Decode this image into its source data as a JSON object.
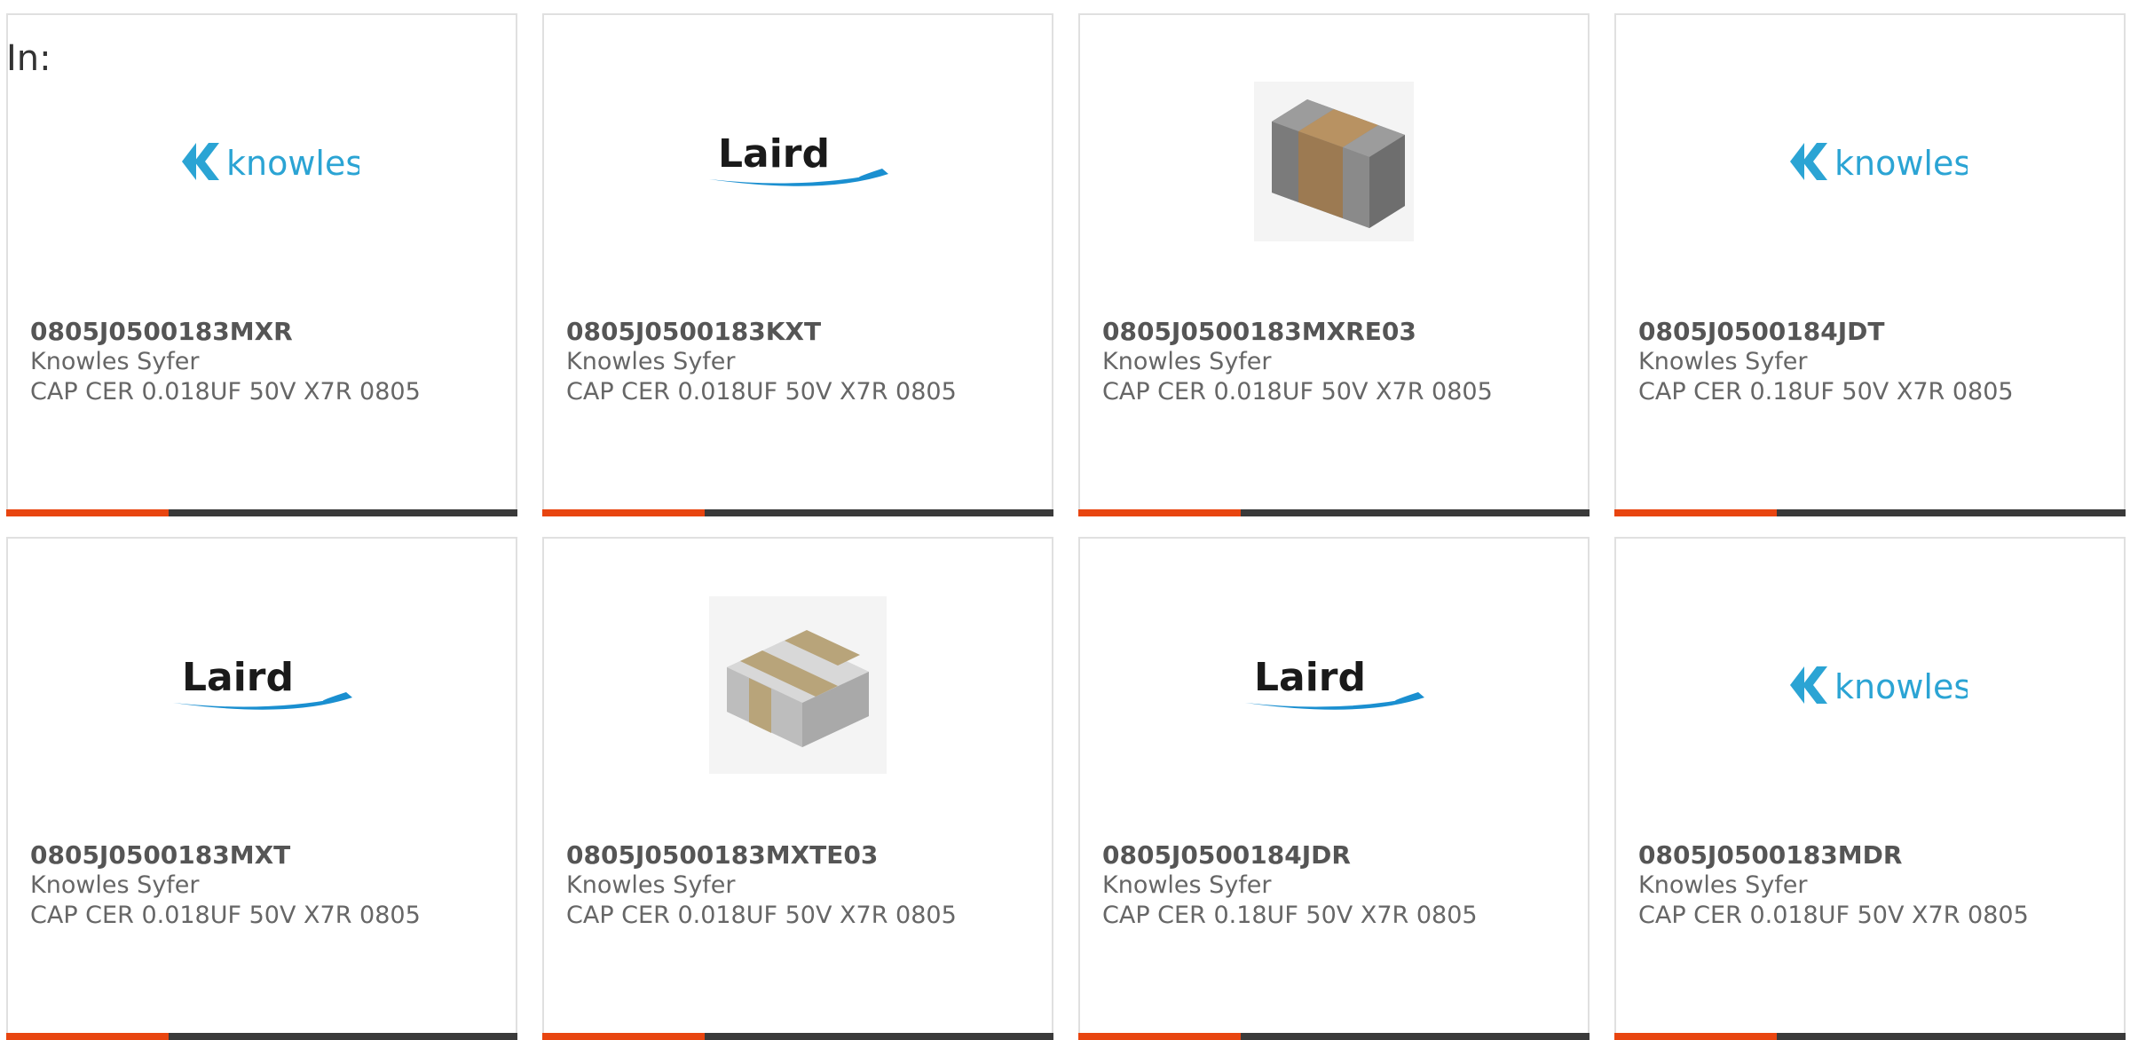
{
  "header": {
    "in_label": "In:"
  },
  "colors": {
    "accent": "#e84510",
    "bar": "#3a3a3a",
    "knowles_blue": "#2ba4d4",
    "laird_blue": "#1a8fd0"
  },
  "products": [
    {
      "part_number": "0805J0500183MXR",
      "manufacturer": "Knowles Syfer",
      "description": "CAP CER 0.018UF 50V X7R 0805",
      "image": "knowles-logo",
      "logo_text": "knowles"
    },
    {
      "part_number": "0805J0500183KXT",
      "manufacturer": "Knowles Syfer",
      "description": "CAP CER 0.018UF 50V X7R 0805",
      "image": "laird-logo",
      "logo_text": "Laird"
    },
    {
      "part_number": "0805J0500183MXRE03",
      "manufacturer": "Knowles Syfer",
      "description": "CAP CER 0.018UF 50V X7R 0805",
      "image": "capacitor-chip-photo"
    },
    {
      "part_number": "0805J0500184JDT",
      "manufacturer": "Knowles Syfer",
      "description": "CAP CER 0.18UF 50V X7R 0805",
      "image": "knowles-logo",
      "logo_text": "knowles"
    },
    {
      "part_number": "0805J0500183MXT",
      "manufacturer": "Knowles Syfer",
      "description": "CAP CER 0.018UF 50V X7R 0805",
      "image": "laird-logo",
      "logo_text": "Laird"
    },
    {
      "part_number": "0805J0500183MXTE03",
      "manufacturer": "Knowles Syfer",
      "description": "CAP CER 0.018UF 50V X7R 0805",
      "image": "capacitor-array-photo"
    },
    {
      "part_number": "0805J0500184JDR",
      "manufacturer": "Knowles Syfer",
      "description": "CAP CER 0.18UF 50V X7R 0805",
      "image": "laird-logo",
      "logo_text": "Laird"
    },
    {
      "part_number": "0805J0500183MDR",
      "manufacturer": "Knowles Syfer",
      "description": "CAP CER 0.018UF 50V X7R 0805",
      "image": "knowles-logo",
      "logo_text": "knowles"
    }
  ]
}
